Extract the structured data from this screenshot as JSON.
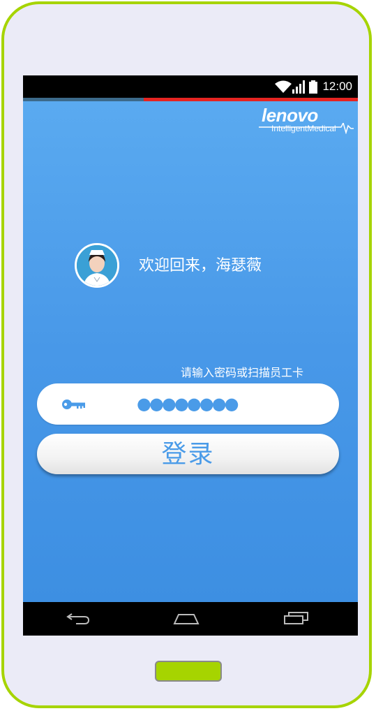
{
  "status_bar": {
    "time": "12:00",
    "icons": [
      "wifi-icon",
      "signal-icon",
      "battery-icon"
    ]
  },
  "loading_progress": 0.36,
  "logo": {
    "main_text": "lenovo",
    "sub_text": "IntelligentMedical"
  },
  "user": {
    "avatar": "nurse-avatar",
    "welcome_text": "欢迎回来，海瑟薇"
  },
  "login_form": {
    "hint": "请输入密码或扫描员工卡",
    "password_icon": "key-icon",
    "password_value": "●●●●●●●●",
    "login_button_label": "登录"
  },
  "nav_bar": {
    "buttons": [
      "back-icon",
      "home-icon",
      "recent-apps-icon"
    ]
  },
  "colors": {
    "phone_frame": "#a6d400",
    "background_top": "#5aaaf0",
    "background_bottom": "#3d8fe2",
    "accent_blue": "#4a9be8",
    "progress_red": "#e52421"
  }
}
